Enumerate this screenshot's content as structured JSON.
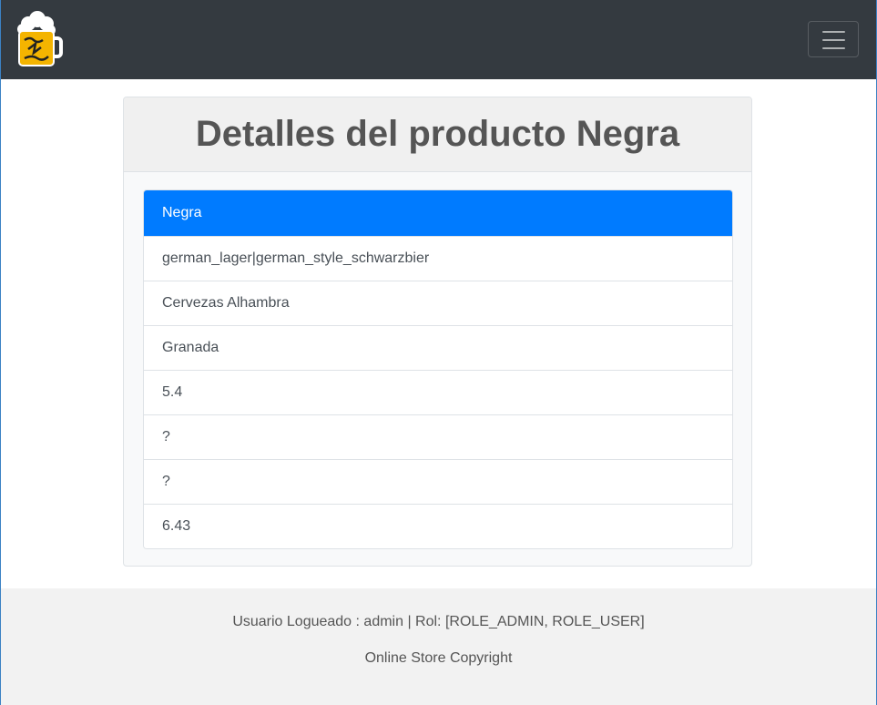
{
  "navbar": {
    "logo_icon": "beer-mug-logo-icon",
    "menu_icon": "hamburger-menu-icon",
    "bg_color": "#343a40"
  },
  "card": {
    "title": "Detalles del producto Negra",
    "items": [
      "Negra",
      "german_lager|german_style_schwarzbier",
      "Cervezas Alhambra",
      "Granada",
      "5.4",
      "?",
      "?",
      "6.43"
    ],
    "active_color": "#007bff"
  },
  "footer": {
    "user_text": "Usuario Logueado : admin | Rol: [ROLE_ADMIN, ROLE_USER]",
    "copyright": "Online Store Copyright"
  }
}
